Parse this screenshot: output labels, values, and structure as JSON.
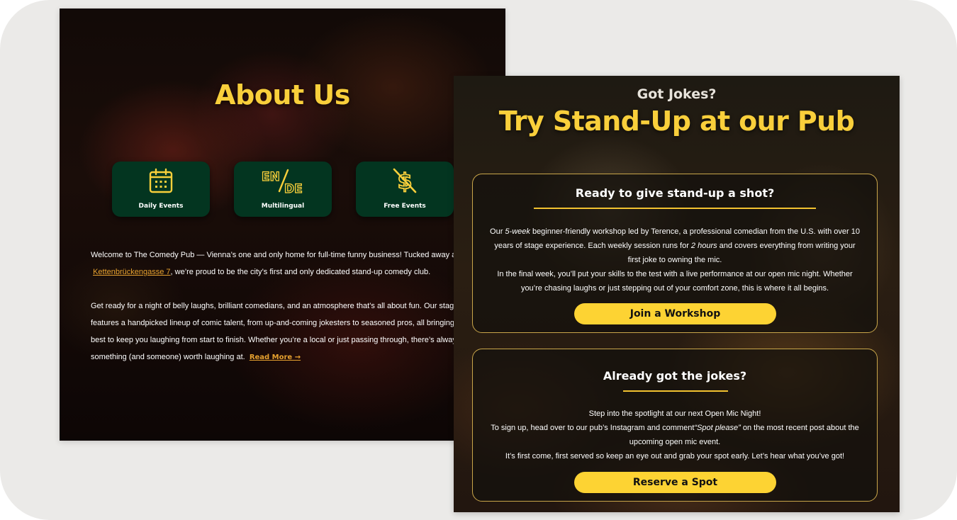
{
  "about": {
    "title": "About Us",
    "features": [
      {
        "icon": "calendar-icon",
        "label": "Daily Events"
      },
      {
        "icon": "language-en-de-icon",
        "label": "Multilingual"
      },
      {
        "icon": "no-dollar-icon",
        "label": "Free Events"
      }
    ],
    "paragraph1_lines": [
      "Welcome to The Comedy Pub — Vienna’s one and only home for full-time funny business! Tucked away at",
      ", we’re proud to be the city’s first and only dedicated stand-up comedy club."
    ],
    "address_link": "Kettenbrückengasse 7",
    "paragraph2_lines": [
      "Get ready for a night of belly laughs, brilliant comedians, and an atmosphere that’s all about fun. Our stag",
      "features a handpicked lineup of comic talent, from up-and-coming jokesters to seasoned pros, all bringing",
      "best to keep you laughing from start to finish. Whether you’re a local or just passing through, there’s alway",
      "something (and someone) worth laughing at."
    ],
    "read_more": "Read More →"
  },
  "standup": {
    "kicker": "Got Jokes?",
    "title": "Try Stand-Up at our Pub",
    "card1": {
      "heading": "Ready to give stand-up a shot?",
      "l1_a": "Our ",
      "l1_em": "5-week",
      "l1_b": " beginner-friendly workshop led by Terence, a professional comedian from the U.S. with over 10",
      "l2_a": "years of stage experience. Each weekly session runs for ",
      "l2_em": "2 hours",
      "l2_b": " and covers everything from writing your",
      "l3": "first joke to owning the mic.",
      "l4": "In the final week, you’ll put your skills to the test with a live performance at our open mic night. Whether",
      "l5": "you’re chasing laughs or just stepping out of your comfort zone, this is where it all begins.",
      "button": "Join a Workshop"
    },
    "card2": {
      "heading": "Already got the jokes?",
      "l1": "Step into the spotlight at our next Open Mic Night!",
      "l2_a": "To sign up, head over to our pub’s Instagram and comment",
      "l2_em": "“Spot please”",
      "l2_b": " on the most recent post about the",
      "l3": "upcoming open mic event.",
      "l4": "It’s first come, first served so keep an eye out and grab your spot early. Let’s hear what you’ve got!",
      "button": "Reserve a Spot"
    }
  },
  "colors": {
    "accent_yellow": "#f9cf3b",
    "feature_green": "#033520",
    "link_orange": "#e6a12f"
  }
}
